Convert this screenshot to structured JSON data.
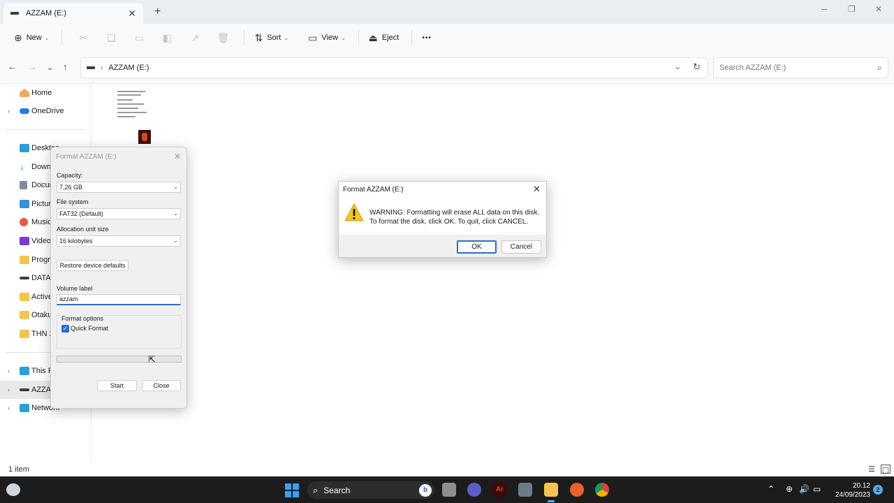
{
  "window": {
    "tab_title": "AZZAM (E:)",
    "tab_close": "✕",
    "new_tab": "+",
    "minimize": "─",
    "maximize": "❐",
    "close": "✕"
  },
  "toolbar": {
    "new_label": "New",
    "sort_label": "Sort",
    "view_label": "View",
    "eject_label": "Eject",
    "more_label": "•••"
  },
  "address": {
    "breadcrumb": "AZZAM (E:)",
    "search_placeholder": "Search AZZAM (E:)"
  },
  "sidebar": {
    "items": [
      {
        "label": "Home",
        "icon": "home-icon"
      },
      {
        "label": "OneDrive",
        "icon": "onedrive-icon"
      },
      {
        "label": "Desktop",
        "icon": "desktop-icon"
      },
      {
        "label": "Downloads",
        "icon": "downloads-icon"
      },
      {
        "label": "Documents",
        "icon": "documents-icon"
      },
      {
        "label": "Pictures",
        "icon": "pictures-icon"
      },
      {
        "label": "Music",
        "icon": "music-icon"
      },
      {
        "label": "Videos",
        "icon": "videos-icon"
      },
      {
        "label": "Programs",
        "icon": "folder-icon"
      },
      {
        "label": "DATA",
        "icon": "drive-icon"
      },
      {
        "label": "Active",
        "icon": "folder-icon"
      },
      {
        "label": "Otaku",
        "icon": "folder-icon"
      },
      {
        "label": "THN 2",
        "icon": "folder-icon"
      },
      {
        "label": "This PC",
        "icon": "pc-icon"
      },
      {
        "label": "AZZAM (E:)",
        "icon": "drive-icon"
      },
      {
        "label": "Network",
        "icon": "network-icon"
      }
    ]
  },
  "status": {
    "item_count": "1 item"
  },
  "format_dialog": {
    "title": "Format AZZAM (E:)",
    "capacity_label": "Capacity:",
    "capacity_value": "7,26 GB",
    "filesystem_label": "File system",
    "filesystem_value": "FAT32 (Default)",
    "allocation_label": "Allocation unit size",
    "allocation_value": "16 kilobytes",
    "restore_button": "Restore device defaults",
    "volume_label": "Volume label",
    "volume_value": "azzam",
    "options_title": "Format options",
    "quick_format_label": "Quick Format",
    "quick_format_checked": true,
    "start_button": "Start",
    "close_button": "Close"
  },
  "warning_dialog": {
    "title": "Format AZZAM (E:)",
    "line1": "WARNING: Formatting will erase ALL data on this disk.",
    "line2": "To format the disk, click OK. To quit, click CANCEL.",
    "ok_button": "OK",
    "cancel_button": "Cancel"
  },
  "taskbar": {
    "search_label": "Search",
    "time": "20.12",
    "date": "24/09/2023",
    "notification_count": "2"
  },
  "colors": {
    "accent": "#2c6ccf",
    "folder": "#f3c44f",
    "taskbar": "#1c1c1c"
  }
}
